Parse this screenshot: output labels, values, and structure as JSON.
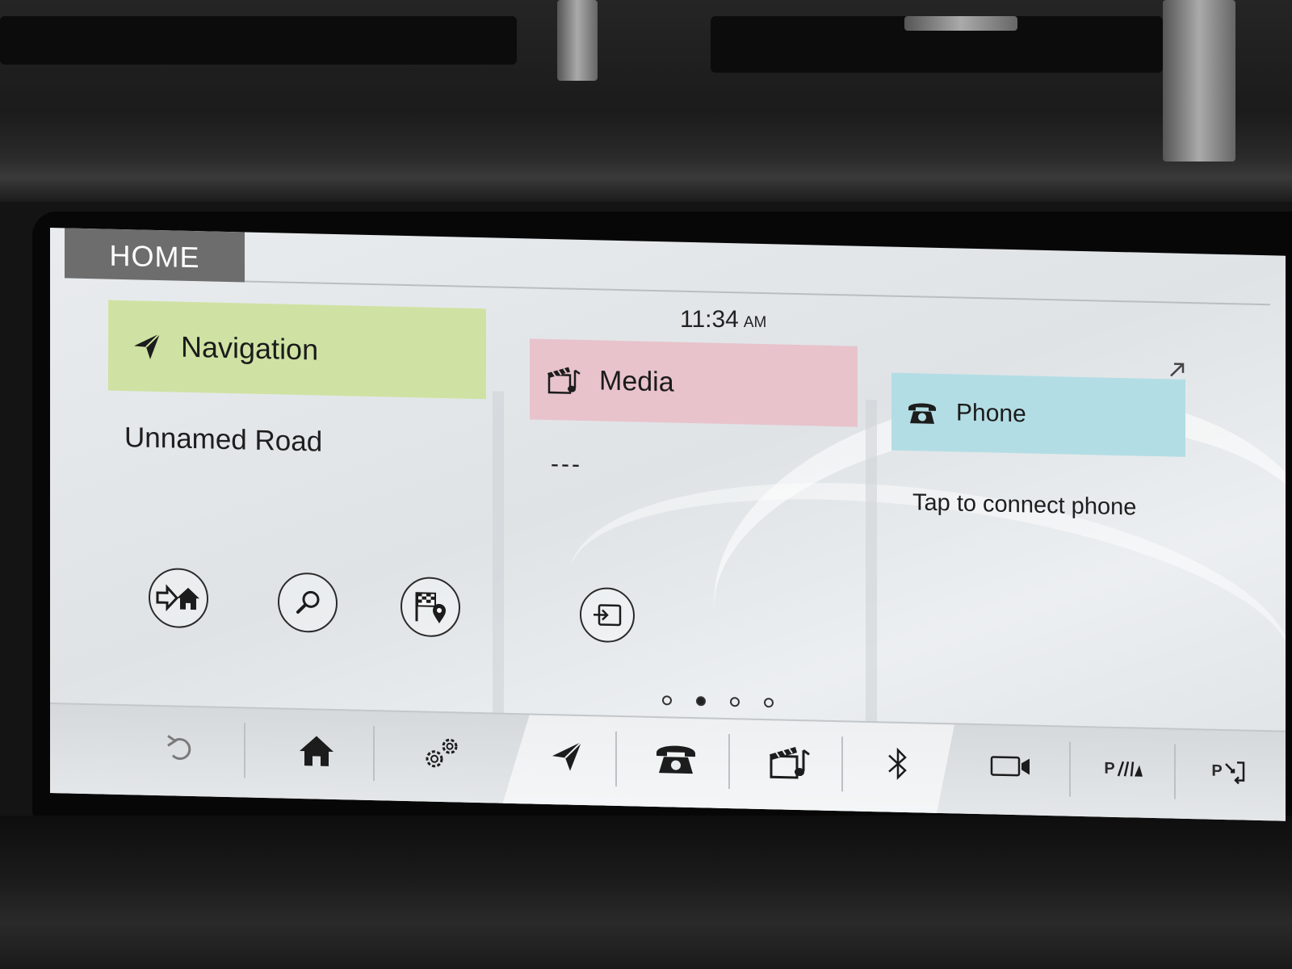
{
  "header": {
    "tab_label": "HOME",
    "time": "11:34",
    "time_period": "AM"
  },
  "tiles": {
    "navigation": {
      "title": "Navigation",
      "subtitle": "Unnamed Road",
      "color": "#cfe2a3",
      "actions": [
        {
          "icon": "go-home-icon"
        },
        {
          "icon": "search-icon"
        },
        {
          "icon": "destination-flag-icon"
        }
      ]
    },
    "media": {
      "title": "Media",
      "subtitle": "---",
      "color": "#e8c3cc",
      "actions": [
        {
          "icon": "source-input-icon"
        }
      ]
    },
    "phone": {
      "title": "Phone",
      "subtitle": "Tap to connect phone",
      "color": "#b3dde4"
    }
  },
  "pagination": {
    "page_count": 4,
    "active_page": 2
  },
  "bottom_bar": {
    "items": [
      {
        "icon": "back-icon"
      },
      {
        "icon": "home-icon"
      },
      {
        "icon": "settings-gears-icon"
      },
      {
        "icon": "navigation-arrow-icon"
      },
      {
        "icon": "phone-icon"
      },
      {
        "icon": "media-clapper-icon"
      },
      {
        "icon": "bluetooth-icon"
      },
      {
        "icon": "camera-icon"
      },
      {
        "icon": "parking-assist-icon",
        "label": "P"
      },
      {
        "icon": "park-exit-icon",
        "label": "P"
      }
    ]
  }
}
